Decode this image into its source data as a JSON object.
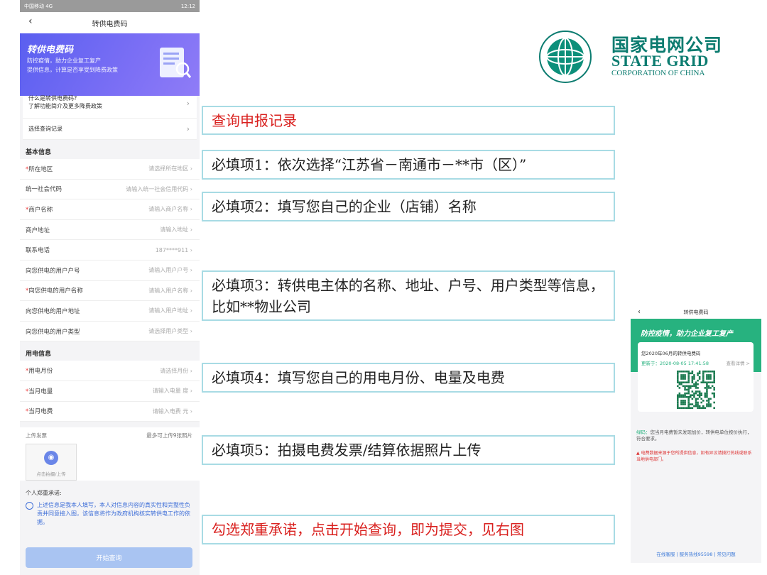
{
  "phone": {
    "status_left": "中国移动 4G",
    "status_right": "12:12",
    "nav_title": "转供电费码",
    "banner_title": "转供电费码",
    "banner_line1": "防控疫情，助力企业复工复产",
    "banner_line2": "提供信息，计算是否享受到降费政策",
    "card_row1_line1": "什么是转供电费码?",
    "card_row1_line2": "了解功能简介及更多降费政策",
    "card_row2": "选择查询记录",
    "section_basic": "基本信息",
    "section_usage": "用电信息",
    "fields": [
      {
        "required": true,
        "label": "所在地区",
        "placeholder": "请选择所在地区"
      },
      {
        "required": false,
        "label": "统一社会代码",
        "placeholder": "请输入统一社会信用代码"
      },
      {
        "required": true,
        "label": "商户名称",
        "placeholder": "请输入商户名称"
      },
      {
        "required": false,
        "label": "商户地址",
        "placeholder": "请输入地址"
      },
      {
        "required": false,
        "label": "联系电话",
        "placeholder": "187****911"
      },
      {
        "required": false,
        "label": "向您供电的用户户号",
        "placeholder": "请输入用户户号"
      },
      {
        "required": true,
        "label": "向您供电的用户名称",
        "placeholder": "请输入用户名称"
      },
      {
        "required": false,
        "label": "向您供电的用户地址",
        "placeholder": "请输入用户地址"
      },
      {
        "required": false,
        "label": "向您供电的用户类型",
        "placeholder": "请选择用户类型"
      }
    ],
    "usage_fields": [
      {
        "required": true,
        "label": "用电月份",
        "placeholder": "请选择月份"
      },
      {
        "required": true,
        "label": "当月电量",
        "placeholder": "请输入电量 度"
      },
      {
        "required": true,
        "label": "当月电费",
        "placeholder": "请输入电费 元"
      }
    ],
    "upload_label": "上传发票",
    "upload_hint": "最多可上传9张照片",
    "upload_button": "点击拍摄/上传",
    "promise_title": "个人郑重承诺:",
    "promise_text": "上述信息是我本人填写，本人对信息内容的真实性和完整性负责并同意接入图，该信息将作为政府机构核实转供电工作的依据。",
    "submit": "开始查询"
  },
  "logo": {
    "cn": "国家电网公司",
    "en1": "STATE GRID",
    "en2": "CORPORATION OF CHINA"
  },
  "callouts": [
    "查询申报记录",
    "必填项1：依次选择“江苏省－南通市－**市（区）”",
    "必填项2：填写您自己的企业（店铺）名称",
    "必填项3：转供电主体的名称、地址、户号、用户类型等信息，比如**物业公司",
    "必填项4：填写您自己的用电月份、电量及电费",
    "必填项5：拍摄电费发票/结算依据照片上传",
    "勾选郑重承诺，点击开始查询，即为提交，见右图"
  ],
  "phone2": {
    "nav_title": "转供电费码",
    "banner": "防控疫情，助力企业复工复产",
    "q_title": "您2020年06月的转供电费码",
    "q_time": "更新于：2020-08-05 17:41:58",
    "q_link": "查看详情 >",
    "tip_label": "绿码：",
    "tip_text": "您当月电费暂未发现加价，转供电单位按价执行，符合要求。",
    "warn_text": "▲ 电费数据来源于您所提供信息，如有异议请拨打热线或联系当地供电部门。",
    "footer": "在线客服 | 服务热线95598 | 常见问题"
  }
}
